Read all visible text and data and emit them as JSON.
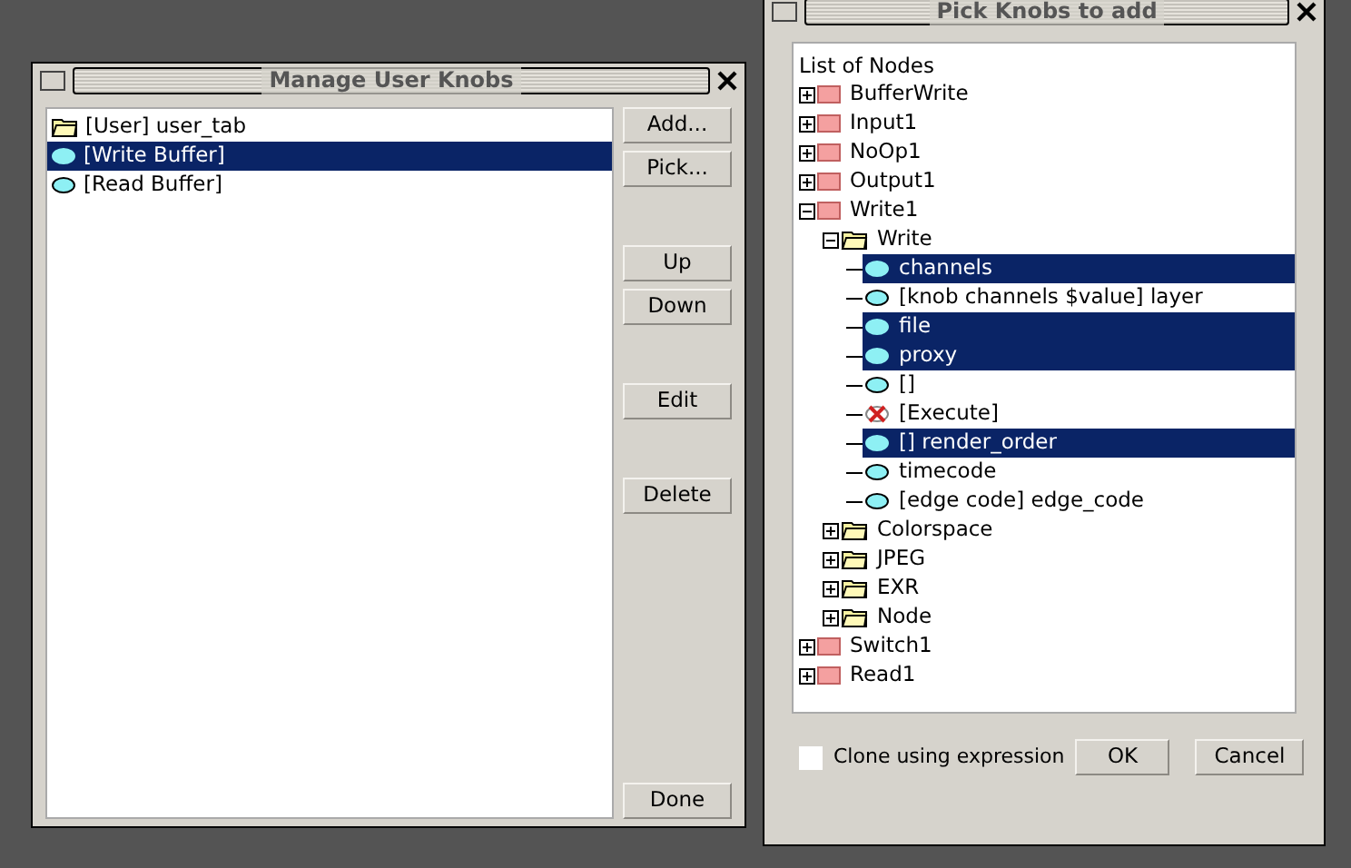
{
  "manage_window": {
    "title": "Manage User Knobs",
    "items": [
      {
        "label": "[User] user_tab",
        "kind": "folder",
        "selected": false
      },
      {
        "label": "[Write Buffer]",
        "kind": "knob",
        "selected": true
      },
      {
        "label": "[Read Buffer]",
        "kind": "knob",
        "selected": false
      }
    ],
    "button_groups": [
      [
        "Add...",
        "Pick..."
      ],
      [
        "Up",
        "Down"
      ],
      [
        "Edit"
      ],
      [
        "Delete"
      ],
      [
        "Done"
      ]
    ]
  },
  "pick_window": {
    "title": "Pick Knobs to add",
    "tree_heading": "List of Nodes",
    "tree": [
      {
        "label": "BufferWrite",
        "kind": "node",
        "expanded": false,
        "selected": false
      },
      {
        "label": "Input1",
        "kind": "node",
        "expanded": false,
        "selected": false
      },
      {
        "label": "NoOp1",
        "kind": "node",
        "expanded": false,
        "selected": false
      },
      {
        "label": "Output1",
        "kind": "node",
        "expanded": false,
        "selected": false
      },
      {
        "label": "Write1",
        "kind": "node",
        "expanded": true,
        "selected": false,
        "children": [
          {
            "label": "Write",
            "kind": "folder",
            "expanded": true,
            "selected": false,
            "children": [
              {
                "label": "channels",
                "kind": "knob",
                "selected": true
              },
              {
                "label": "[knob channels $value] layer",
                "kind": "knob",
                "selected": false
              },
              {
                "label": "file",
                "kind": "knob",
                "selected": true
              },
              {
                "label": "proxy",
                "kind": "knob",
                "selected": true
              },
              {
                "label": "[]",
                "kind": "knob",
                "selected": false
              },
              {
                "label": "[Execute]",
                "kind": "error",
                "selected": false
              },
              {
                "label": "[] render_order",
                "kind": "knob",
                "selected": true
              },
              {
                "label": "timecode",
                "kind": "knob",
                "selected": false
              },
              {
                "label": "[edge code] edge_code",
                "kind": "knob",
                "selected": false
              }
            ]
          },
          {
            "label": "Colorspace",
            "kind": "folder",
            "expanded": false,
            "selected": false
          },
          {
            "label": "JPEG",
            "kind": "folder",
            "expanded": false,
            "selected": false
          },
          {
            "label": "EXR",
            "kind": "folder",
            "expanded": false,
            "selected": false
          },
          {
            "label": "Node",
            "kind": "folder",
            "expanded": false,
            "selected": false
          }
        ]
      },
      {
        "label": "Switch1",
        "kind": "node",
        "expanded": false,
        "selected": false
      },
      {
        "label": "Read1",
        "kind": "node",
        "expanded": false,
        "selected": false
      }
    ],
    "clone_checkbox": {
      "label": "Clone using expression",
      "checked": false
    },
    "buttons": [
      "OK",
      "Cancel"
    ]
  }
}
